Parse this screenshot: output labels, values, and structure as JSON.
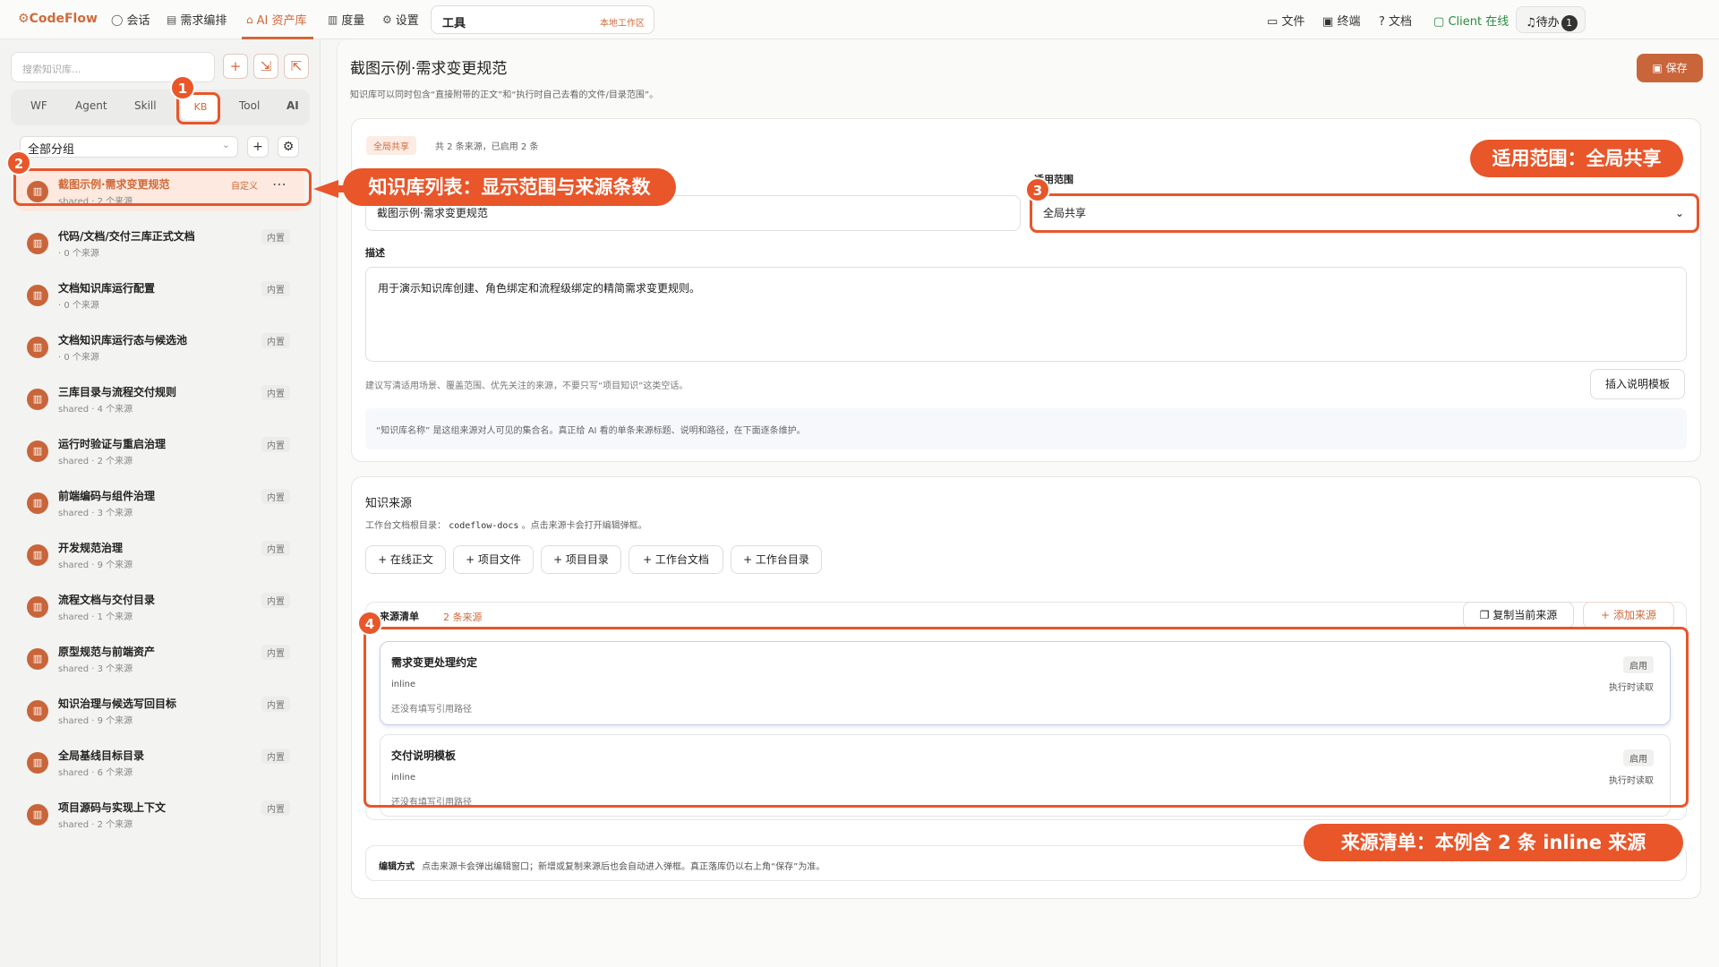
{
  "app": {
    "logo": "CodeFlow"
  },
  "nav": [
    {
      "label": "会话",
      "icon": "chat-icon"
    },
    {
      "label": "需求编排",
      "icon": "document-icon"
    },
    {
      "label": "AI 资产库",
      "icon": "assets-icon"
    },
    {
      "label": "度量",
      "icon": "chart-icon"
    },
    {
      "label": "设置",
      "icon": "gear-icon"
    }
  ],
  "toolbox": {
    "title": "工具",
    "workspace": "本地工作区"
  },
  "right_nav": [
    {
      "label": "文件",
      "icon": "folder-icon"
    },
    {
      "label": "终端",
      "icon": "terminal-icon"
    },
    {
      "label": "文档",
      "icon": "help-icon"
    },
    {
      "label": "Client 在线",
      "icon": "monitor-icon"
    }
  ],
  "todo": {
    "label": "待办",
    "count": "1"
  },
  "sidebar": {
    "search_placeholder": "搜索知识库...",
    "tabs": [
      "WF",
      "Agent",
      "Skill",
      "KB",
      "Tool",
      "AI"
    ],
    "group": "全部分组",
    "items": [
      {
        "name": "截图示例·需求变更规范",
        "sub": "shared · 2 个来源",
        "tag": "自定义"
      },
      {
        "name": "代码/文档/交付三库正式文档",
        "sub": "· 0 个来源",
        "tag": "内置"
      },
      {
        "name": "文档知识库运行配置",
        "sub": "· 0 个来源",
        "tag": "内置"
      },
      {
        "name": "文档知识库运行态与候选池",
        "sub": "· 0 个来源",
        "tag": "内置"
      },
      {
        "name": "三库目录与流程交付规则",
        "sub": "shared · 4 个来源",
        "tag": "内置"
      },
      {
        "name": "运行时验证与重启治理",
        "sub": "shared · 2 个来源",
        "tag": "内置"
      },
      {
        "name": "前端编码与组件治理",
        "sub": "shared · 3 个来源",
        "tag": "内置"
      },
      {
        "name": "开发规范治理",
        "sub": "shared · 9 个来源",
        "tag": "内置"
      },
      {
        "name": "流程文档与交付目录",
        "sub": "shared · 1 个来源",
        "tag": "内置"
      },
      {
        "name": "原型规范与前端资产",
        "sub": "shared · 3 个来源",
        "tag": "内置"
      },
      {
        "name": "知识治理与候选写回目标",
        "sub": "shared · 9 个来源",
        "tag": "内置"
      },
      {
        "name": "全局基线目标目录",
        "sub": "shared · 6 个来源",
        "tag": "内置"
      },
      {
        "name": "项目源码与实现上下文",
        "sub": "shared · 2 个来源",
        "tag": "内置"
      }
    ]
  },
  "detail": {
    "title": "截图示例·需求变更规范",
    "desc": "知识库可以同时包含“直接附带的正文”和“执行时自己去看的文件/目录范围”。",
    "save": "保存",
    "scope_tag": "全局共享",
    "scope_info": "共 2 条来源，已启用 2 条",
    "name_value": "截图示例·需求变更规范",
    "scope_label": "适用范围",
    "scope_value": "全局共享",
    "desc_label": "描述",
    "desc_value": "用于演示知识库创建、角色绑定和流程级绑定的精简需求变更规则。",
    "hint": "建议写清适用场景、覆盖范围、优先关注的来源，不要只写“项目知识”这类空话。",
    "template_btn": "插入说明模板",
    "info": "“知识库名称” 是这组来源对人可见的集合名。真正给 AI 看的单条来源标题、说明和路径，在下面逐条维护。"
  },
  "sources": {
    "title": "知识来源",
    "root_label": "工作台文档根目录：",
    "root_path": "codeflow-docs",
    "root_suffix": "。点击来源卡会打开编辑弹框。",
    "add_buttons": [
      "+ 在线正文",
      "+ 项目文件",
      "+ 项目目录",
      "+ 工作台文档",
      "+ 工作台目录"
    ],
    "list_label": "来源清单",
    "list_count": "2 条来源",
    "copy_btn": "复制当前来源",
    "add_btn": "添加来源",
    "items": [
      {
        "title": "需求变更处理约定",
        "kind": "inline",
        "path": "还没有填写引用路径",
        "status": "启用",
        "read": "执行时读取"
      },
      {
        "title": "交付说明模板",
        "kind": "inline",
        "path": "还没有填写引用路径",
        "status": "启用",
        "read": "执行时读取"
      }
    ],
    "edit_label": "编辑方式",
    "edit_text": "点击来源卡会弹出编辑窗口；新增或复制来源后也会自动进入弹框。真正落库仍以右上角“保存”为准。"
  },
  "annotations": {
    "badges": [
      "1",
      "2",
      "3",
      "4"
    ],
    "callout_list": "知识库列表：显示范围与来源条数",
    "callout_scope": "适用范围：全局共享",
    "callout_sources": "来源清单：本例含 2 条 inline 来源"
  },
  "colors": {
    "accent": "#cf6a3b",
    "annotation": "#e8562a"
  }
}
